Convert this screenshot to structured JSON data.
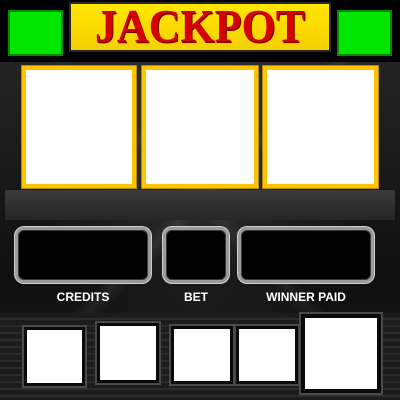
{
  "header": {
    "title": "JACKPOT",
    "side_light_color": "#00e600",
    "banner_color": "#ffe600",
    "title_color": "#d50000"
  },
  "reels": {
    "count": 3,
    "frame_color": "#ffc400",
    "window_color": "#ffffff"
  },
  "displays": [
    {
      "label": "CREDITS"
    },
    {
      "label": "BET"
    },
    {
      "label": "WINNER PAID"
    }
  ],
  "buttons": {
    "count": 5,
    "color": "#ffffff"
  }
}
